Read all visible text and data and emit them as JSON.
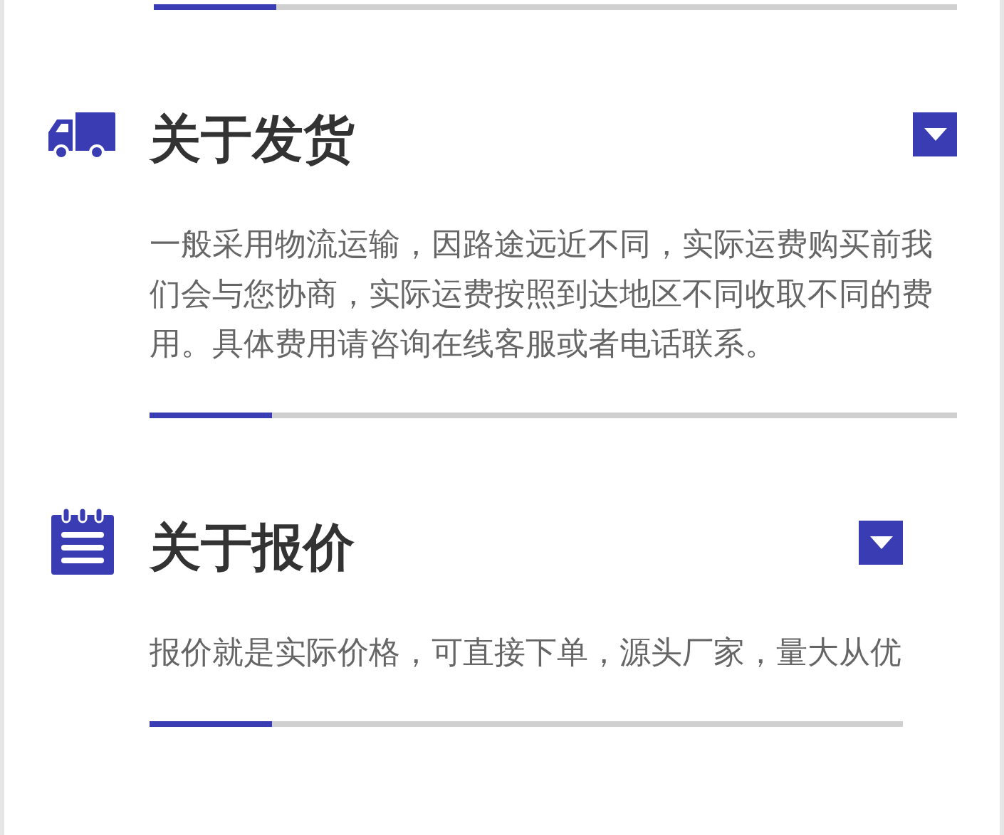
{
  "sections": [
    {
      "kind": "truck",
      "title": "关于发货",
      "text": "一般采用物流运输，因路途远近不同，实际运费购买前我们会与您协商，实际运费按照到达地区不同收取不同的费用。具体费用请咨询在线客服或者电话联系。"
    },
    {
      "kind": "notepad",
      "title": "关于报价",
      "text": "报价就是实际价格，可直接下单，源头厂家，量大从优"
    }
  ]
}
